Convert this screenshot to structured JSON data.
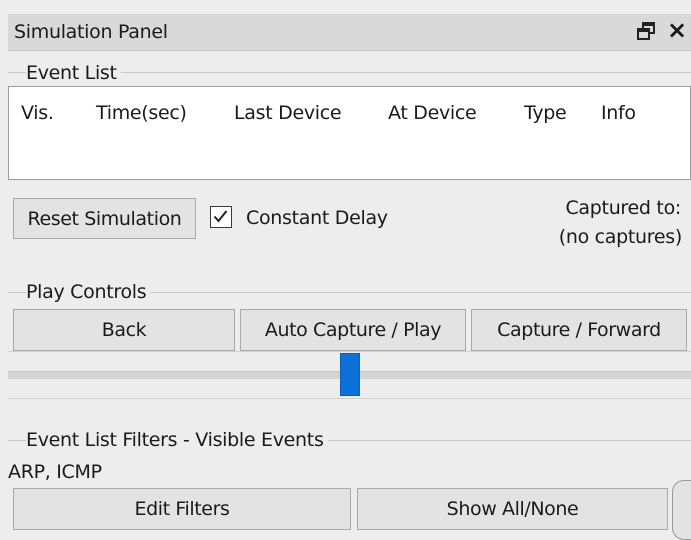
{
  "panel": {
    "title": "Simulation Panel",
    "close_symbol": "×",
    "restore_icon": "restore-window-icon"
  },
  "event_list": {
    "label": "Event List",
    "columns": [
      "Vis.",
      "Time(sec)",
      "Last Device",
      "At Device",
      "Type",
      "Info"
    ],
    "rows": []
  },
  "controls": {
    "reset_label": "Reset Simulation",
    "constant_delay_label": "Constant Delay",
    "constant_delay_checked": true,
    "captured_to_label": "Captured to:",
    "captured_to_value": "(no captures)"
  },
  "play_controls": {
    "label": "Play Controls",
    "back_label": "Back",
    "auto_capture_label": "Auto Capture / Play",
    "capture_forward_label": "Capture / Forward",
    "slider_position_fraction": 0.5
  },
  "filters": {
    "label": "Event List Filters - Visible Events",
    "visible_events": "ARP, ICMP",
    "edit_filters_label": "Edit Filters",
    "show_all_label": "Show All/None"
  },
  "colors": {
    "accent": "#0c72d8",
    "panel_background": "#ededed",
    "titlebar_background": "#d9d9d9"
  }
}
